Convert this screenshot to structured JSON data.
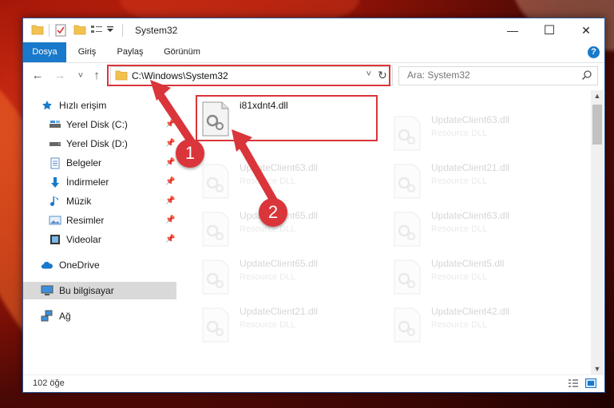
{
  "window": {
    "title": "System32",
    "minimize": "—",
    "maximize": "☐",
    "close": "✕"
  },
  "ribbon": {
    "tabs": [
      "Dosya",
      "Giriş",
      "Paylaş",
      "Görünüm"
    ],
    "active_tab": "Dosya",
    "help": "?"
  },
  "nav": {
    "back": "←",
    "forward": "→",
    "recent": "˅",
    "up": "↑",
    "address": "C:\\Windows\\System32",
    "address_dropdown": "˅",
    "refresh": "↻",
    "search_placeholder": "Ara: System32"
  },
  "sidebar": {
    "items": [
      {
        "label": "Hızlı erişim",
        "icon": "star-icon",
        "pinned": false
      },
      {
        "label": "Yerel Disk (C:)",
        "icon": "drive-icon",
        "pinned": true
      },
      {
        "label": "Yerel Disk (D:)",
        "icon": "drive-icon",
        "pinned": true
      },
      {
        "label": "Belgeler",
        "icon": "document-icon",
        "pinned": true
      },
      {
        "label": "İndirmeler",
        "icon": "download-icon",
        "pinned": true
      },
      {
        "label": "Müzik",
        "icon": "music-icon",
        "pinned": true
      },
      {
        "label": "Resimler",
        "icon": "pictures-icon",
        "pinned": true
      },
      {
        "label": "Videolar",
        "icon": "video-icon",
        "pinned": true
      },
      {
        "label": "OneDrive",
        "icon": "cloud-icon",
        "pinned": false
      },
      {
        "label": "Bu bilgisayar",
        "icon": "computer-icon",
        "pinned": false,
        "selected": true
      },
      {
        "label": "Ağ",
        "icon": "network-icon",
        "pinned": false
      }
    ]
  },
  "files": [
    {
      "name": "i81xdnt4.dll",
      "desc": ""
    },
    {
      "name": "UpdateClient63.dll",
      "desc": "Resource DLL"
    },
    {
      "name": "UpdateClient63.dll",
      "desc": "Resource DLL"
    },
    {
      "name": "UpdateClient21.dll",
      "desc": "Resource DLL"
    },
    {
      "name": "UpdateClient65.dll",
      "desc": "Resource DLL"
    },
    {
      "name": "UpdateClient63.dll",
      "desc": "Resource DLL"
    },
    {
      "name": "UpdateClient65.dll",
      "desc": "Resource DLL"
    },
    {
      "name": "UpdateClient5.dll",
      "desc": "Resource DLL"
    },
    {
      "name": "UpdateClient21.dll",
      "desc": "Resource DLL"
    },
    {
      "name": "UpdateClient42.dll",
      "desc": "Resource DLL"
    }
  ],
  "status": {
    "count": "102 öğe"
  },
  "annotations": {
    "step1": "1",
    "step2": "2",
    "highlight_color": "#d9353a"
  },
  "colors": {
    "accent": "#1979ca",
    "selection": "#d9d9d9"
  }
}
